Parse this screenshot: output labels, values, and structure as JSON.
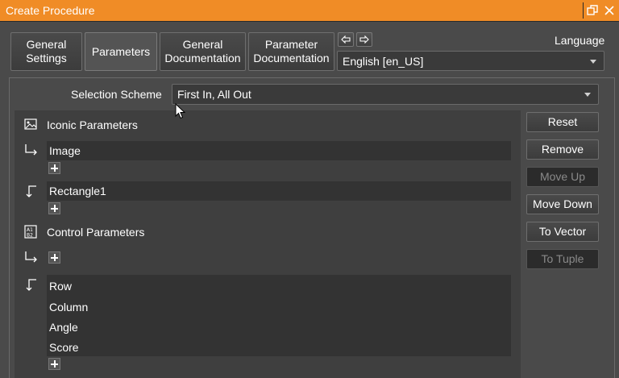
{
  "window": {
    "title": "Create Procedure"
  },
  "tabs": [
    {
      "label": "General\nSettings",
      "active": false
    },
    {
      "label": "Parameters",
      "active": true
    },
    {
      "label": "General\nDocumentation",
      "active": false
    },
    {
      "label": "Parameter\nDocumentation",
      "active": false
    }
  ],
  "language": {
    "label": "Language",
    "selected": "English [en_US]"
  },
  "selection_scheme": {
    "label": "Selection Scheme",
    "selected": "First In, All Out"
  },
  "parameters": {
    "iconic_header": "Iconic Parameters",
    "iconic_inputs": [
      "Image"
    ],
    "iconic_outputs": [
      "Rectangle1"
    ],
    "control_header": "Control Parameters",
    "control_inputs": [],
    "control_outputs": [
      "Row",
      "Column",
      "Angle",
      "Score"
    ]
  },
  "actions": {
    "reset": "Reset",
    "remove": "Remove",
    "move_up": "Move Up",
    "move_down": "Move Down",
    "to_vector": "To Vector",
    "to_tuple": "To Tuple"
  },
  "colors": {
    "title_bar": "#f08c26",
    "background": "#4a4a4a"
  }
}
